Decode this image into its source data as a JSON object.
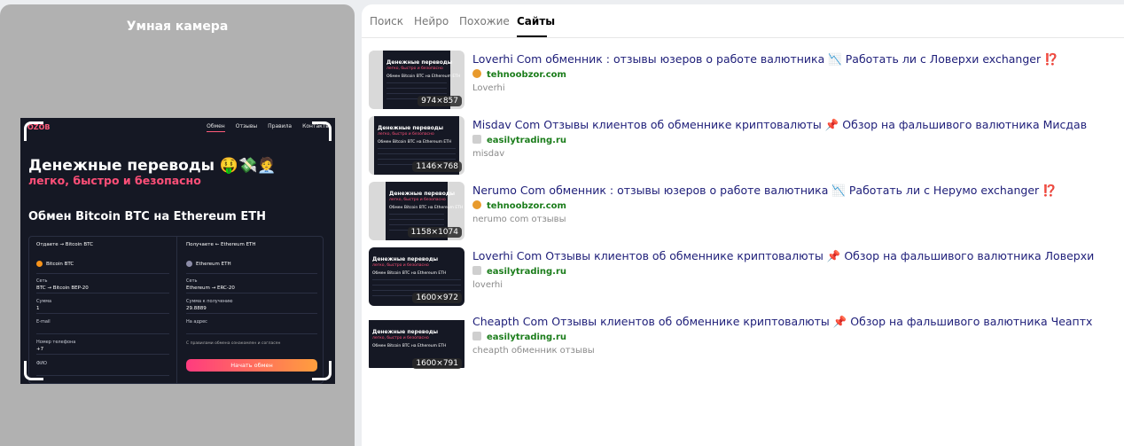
{
  "camera": {
    "title": "Умная камера",
    "screen": {
      "logo": "OZOB",
      "nav": [
        "Обмен",
        "Отзывы",
        "Правила",
        "Контакты"
      ],
      "hero_line1": "Денежные переводы 🤑💸🧑‍💼",
      "hero_line2": "легко, быстро и безопасно",
      "hero_line3": "Обмен Bitcoin BTC на Ethereum ETH",
      "give_label": "Отдаете → Bitcoin BTC",
      "get_label": "Получаете ← Ethereum ETH",
      "give_currency": "Bitcoin BTC",
      "get_currency": "Ethereum ETH",
      "net_label": "Сеть",
      "give_net": "BTC → Bitcoin BEP-20",
      "get_net": "Ethereum → ERC-20",
      "sum_label": "Сумма",
      "give_sum": "1",
      "receive_label": "Сумма к получению",
      "receive_sum": "29.8889",
      "email_label": "E-mail",
      "address_label": "На адрес",
      "phone_label": "Номер телефона",
      "phone_code": "+7",
      "fio_label": "ФИО",
      "agree_text": "С правилами обмена ознакомлен и согласен",
      "submit": "Начать обмен"
    }
  },
  "tabs": {
    "search": "Поиск",
    "neuro": "Нейро",
    "similar": "Похожие",
    "sites": "Сайты"
  },
  "results": [
    {
      "title": "Loverhi Com обменник : отзывы юзеров о работе валютника 📉 Работать ли с Ловерхи exchanger ⁉️",
      "site": "tehnoobzor.com",
      "desc": "Loverhi",
      "size": "974×857"
    },
    {
      "title": "Misdav Com Отзывы клиентов об обменнике криптовалюты 📌 Обзор на фальшивого валютника Мисдав",
      "site": "easilytrading.ru",
      "desc": "misdav",
      "size": "1146×768"
    },
    {
      "title": "Nerumo Com обменник : отзывы юзеров о работе валютника 📉 Работать ли с Нерумо exchanger ⁉️",
      "site": "tehnoobzor.com",
      "desc": "nerumo com отзывы",
      "size": "1158×1074"
    },
    {
      "title": "Loverhi Com Отзывы клиентов об обменнике криптовалюты 📌 Обзор на фальшивого валютника Ловерхи",
      "site": "easilytrading.ru",
      "desc": "loverhi",
      "size": "1600×972"
    },
    {
      "title": "Cheapth Com Отзывы клиентов об обменнике криптовалюты 📌 Обзор на фальшивого валютника Чеаптх",
      "site": "easilytrading.ru",
      "desc": "cheapth обменник отзывы",
      "size": "1600×791"
    }
  ],
  "thumb_text": {
    "t1": "Денежные переводы",
    "t2": "легко, быстро и безопасно",
    "t3": "Обмен Bitcoin BTC на Ethereum ETH"
  }
}
